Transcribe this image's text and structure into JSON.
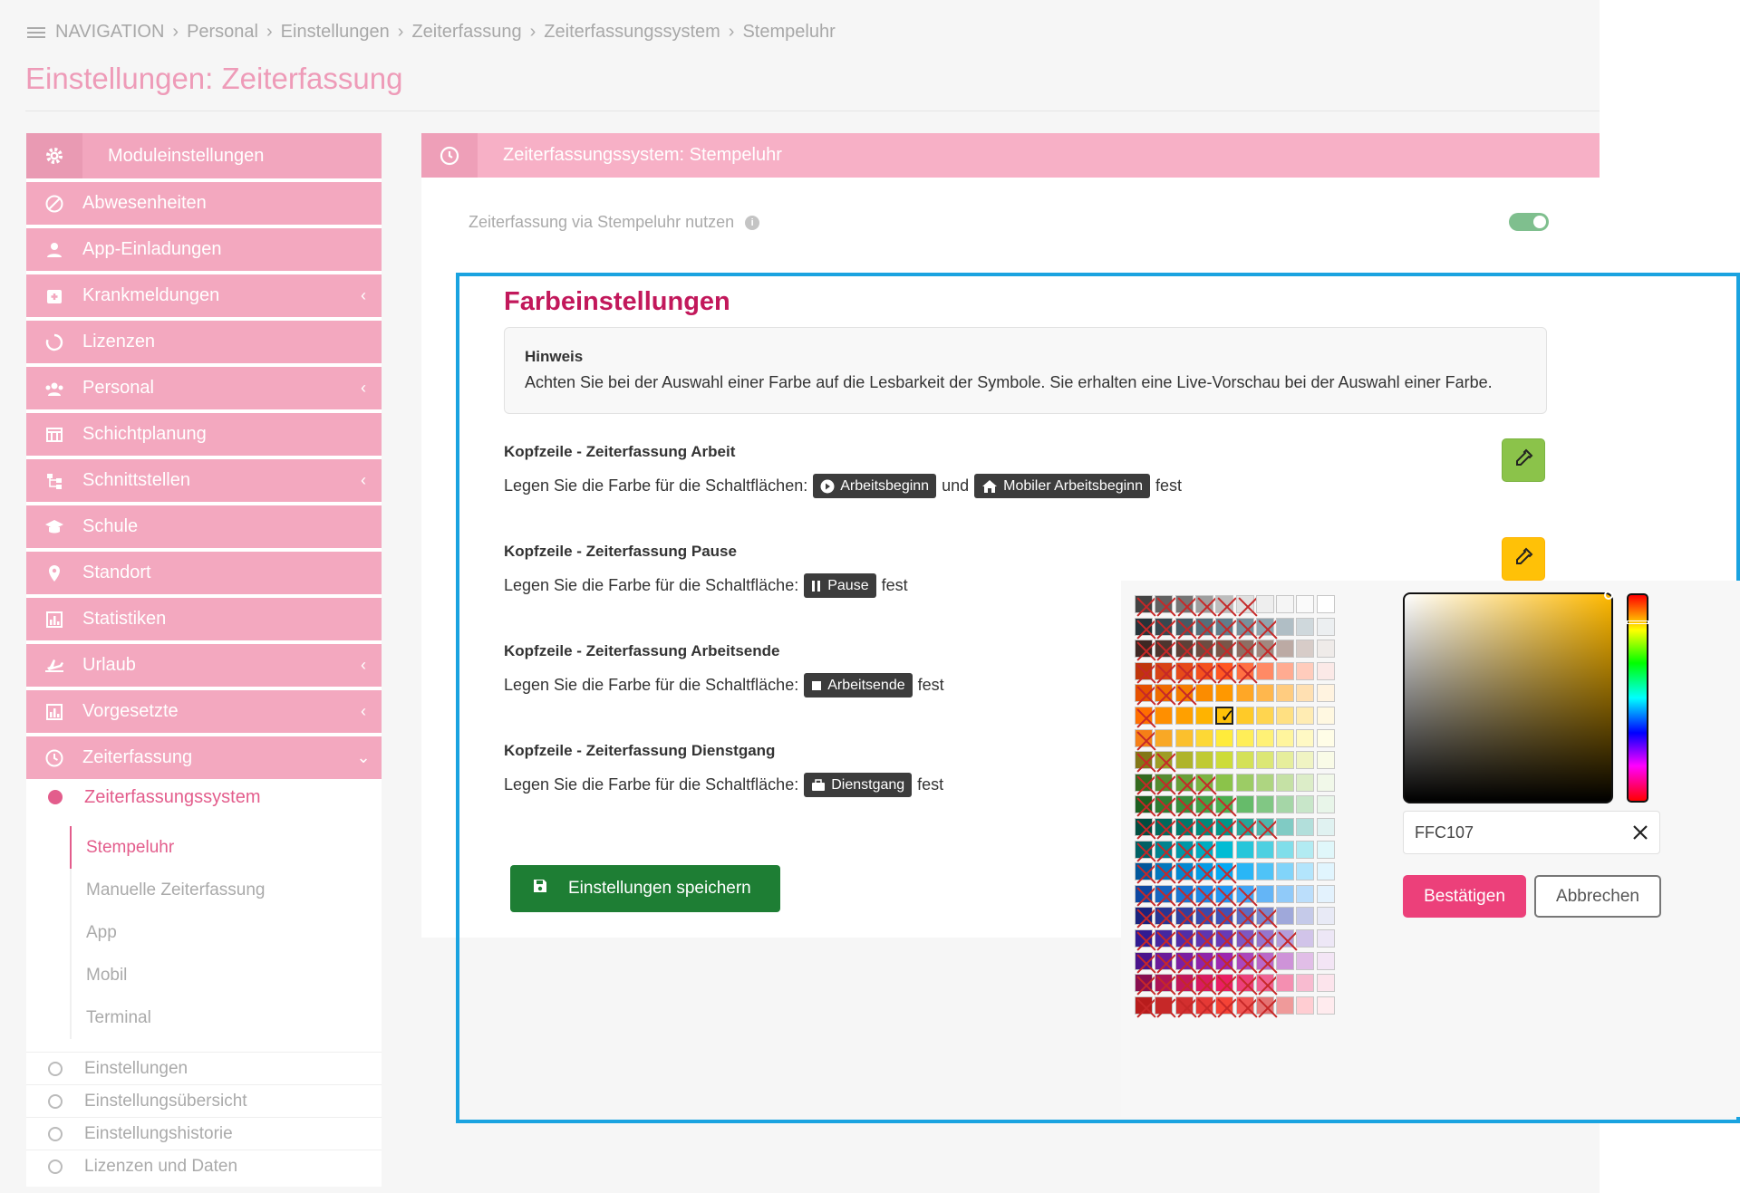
{
  "breadcrumb": [
    "NAVIGATION",
    "Personal",
    "Einstellungen",
    "Zeiterfassung",
    "Zeiterfassungssystem",
    "Stempeluhr"
  ],
  "page_title": "Einstellungen: Zeiterfassung",
  "sidebar": {
    "header": "Moduleinstellungen",
    "items": [
      {
        "label": "Abwesenheiten",
        "icon": "ban-icon",
        "chevron": false
      },
      {
        "label": "App-Einladungen",
        "icon": "user-icon",
        "chevron": false
      },
      {
        "label": "Krankmeldungen",
        "icon": "medical-icon",
        "chevron": true
      },
      {
        "label": "Lizenzen",
        "icon": "circle-notch-icon",
        "chevron": false
      },
      {
        "label": "Personal",
        "icon": "users-icon",
        "chevron": true
      },
      {
        "label": "Schichtplanung",
        "icon": "table-icon",
        "chevron": false
      },
      {
        "label": "Schnittstellen",
        "icon": "sitemap-icon",
        "chevron": true
      },
      {
        "label": "Schule",
        "icon": "graduation-cap-icon",
        "chevron": false
      },
      {
        "label": "Standort",
        "icon": "map-marker-icon",
        "chevron": false
      },
      {
        "label": "Statistiken",
        "icon": "chart-icon",
        "chevron": false
      },
      {
        "label": "Urlaub",
        "icon": "plane-icon",
        "chevron": true
      },
      {
        "label": "Vorgesetzte",
        "icon": "chart-icon",
        "chevron": true
      },
      {
        "label": "Zeiterfassung",
        "icon": "clock-icon",
        "chevron": true
      }
    ],
    "active_sub": "Zeiterfassungssystem",
    "subsub": [
      "Stempeluhr",
      "Manuelle Zeiterfassung",
      "App",
      "Mobil",
      "Terminal"
    ],
    "plain": [
      "Einstellungen",
      "Einstellungsübersicht",
      "Einstellungshistorie",
      "Lizenzen und Daten"
    ]
  },
  "main": {
    "header": "Zeiterfassungssystem: Stempeluhr",
    "toggle_label": "Zeiterfassung via Stempeluhr nutzen",
    "toggle_on": true
  },
  "colors_section": {
    "title": "Farbeinstellungen",
    "hint_title": "Hinweis",
    "hint_text": "Achten Sie bei der Auswahl einer Farbe auf die Lesbarkeit der Symbole. Sie erhalten eine Live-Vorschau bei der Auswahl einer Farbe.",
    "settings": [
      {
        "title": "Kopfzeile - Zeiterfassung Arbeit",
        "prefix": "Legen Sie die Farbe für die Schaltflächen:",
        "chip1": "Arbeitsbeginn",
        "conj": "und",
        "chip2": "Mobiler Arbeitsbeginn",
        "suffix": "fest",
        "color": "#8bc34a"
      },
      {
        "title": "Kopfzeile - Zeiterfassung Pause",
        "prefix": "Legen Sie die Farbe für die Schaltfläche:",
        "chip1": "Pause",
        "suffix": "fest",
        "color": "#ffc107"
      },
      {
        "title": "Kopfzeile - Zeiterfassung Arbeitsende",
        "prefix": "Legen Sie die Farbe für die Schaltfläche:",
        "chip1": "Arbeitsende",
        "suffix": "fest"
      },
      {
        "title": "Kopfzeile - Zeiterfassung Dienstgang",
        "prefix": "Legen Sie die Farbe für die Schaltfläche:",
        "chip1": "Dienstgang",
        "suffix": "fest"
      }
    ],
    "save_label": "Einstellungen speichern"
  },
  "picker": {
    "hex_value": "FFC107",
    "confirm_label": "Bestätigen",
    "cancel_label": "Abbrechen",
    "palette_rows": [
      {
        "colors": [
          "#424242",
          "#616161",
          "#757575",
          "#9e9e9e",
          "#bdbdbd",
          "#e0e0e0",
          "#eeeeee",
          "#f5f5f5",
          "#fafafa",
          "#ffffff"
        ],
        "disabled": 6
      },
      {
        "colors": [
          "#263238",
          "#37474f",
          "#455a64",
          "#546e7a",
          "#607d8b",
          "#78909c",
          "#90a4ae",
          "#b0bec5",
          "#cfd8dc",
          "#eceff1"
        ],
        "disabled": 7
      },
      {
        "colors": [
          "#3e2723",
          "#4e342e",
          "#5d4037",
          "#6d4c41",
          "#795548",
          "#8d6e63",
          "#a1887f",
          "#bcaaa4",
          "#d7ccc8",
          "#efebe9"
        ],
        "disabled": 7
      },
      {
        "colors": [
          "#bf360c",
          "#d84315",
          "#e64a19",
          "#f4511e",
          "#ff5722",
          "#ff7043",
          "#ff8a65",
          "#ffab91",
          "#ffccbc",
          "#fbe9e7"
        ],
        "disabled": 6
      },
      {
        "colors": [
          "#e65100",
          "#ef6c00",
          "#f57c00",
          "#fb8c00",
          "#ff9800",
          "#ffa726",
          "#ffb74d",
          "#ffcc80",
          "#ffe0b2",
          "#fff3e0"
        ],
        "disabled": 3
      },
      {
        "colors": [
          "#ff6f00",
          "#ff8f00",
          "#ffa000",
          "#ffb300",
          "#ffc107",
          "#ffca28",
          "#ffd54f",
          "#ffe082",
          "#ffecb3",
          "#fff8e1"
        ],
        "disabled": 1
      },
      {
        "colors": [
          "#f57f17",
          "#f9a825",
          "#fbc02d",
          "#fdd835",
          "#ffeb3b",
          "#ffee58",
          "#fff176",
          "#fff59d",
          "#fff9c4",
          "#fffde7"
        ],
        "disabled": 1
      },
      {
        "colors": [
          "#827717",
          "#9e9d24",
          "#afb42b",
          "#c0ca33",
          "#cddc39",
          "#d4e157",
          "#dce775",
          "#e6ee9c",
          "#f0f4c3",
          "#f9fbe7"
        ],
        "disabled": 2
      },
      {
        "colors": [
          "#33691e",
          "#558b2f",
          "#689f38",
          "#7cb342",
          "#8bc34a",
          "#9ccc65",
          "#aed581",
          "#c5e1a5",
          "#dcedc8",
          "#f1f8e9"
        ],
        "disabled": 4
      },
      {
        "colors": [
          "#1b5e20",
          "#2e7d32",
          "#388e3c",
          "#43a047",
          "#4caf50",
          "#66bb6a",
          "#81c784",
          "#a5d6a7",
          "#c8e6c9",
          "#e8f5e9"
        ],
        "disabled": 5
      },
      {
        "colors": [
          "#004d40",
          "#00695c",
          "#00796b",
          "#00897b",
          "#009688",
          "#26a69a",
          "#4db6ac",
          "#80cbc4",
          "#b2dfdb",
          "#e0f2f1"
        ],
        "disabled": 7
      },
      {
        "colors": [
          "#006064",
          "#00838f",
          "#0097a7",
          "#00acc1",
          "#00bcd4",
          "#26c6da",
          "#4dd0e1",
          "#80deea",
          "#b2ebf2",
          "#e0f7fa"
        ],
        "disabled": 4
      },
      {
        "colors": [
          "#01579b",
          "#0277bd",
          "#0288d1",
          "#039be5",
          "#03a9f4",
          "#29b6f6",
          "#4fc3f7",
          "#81d4fa",
          "#b3e5fc",
          "#e1f5fe"
        ],
        "disabled": 5
      },
      {
        "colors": [
          "#0d47a1",
          "#1565c0",
          "#1976d2",
          "#1e88e5",
          "#2196f3",
          "#42a5f5",
          "#64b5f6",
          "#90caf9",
          "#bbdefb",
          "#e3f2fd"
        ],
        "disabled": 6
      },
      {
        "colors": [
          "#1a237e",
          "#283593",
          "#303f9f",
          "#3949ab",
          "#3f51b5",
          "#5c6bc0",
          "#7986cb",
          "#9fa8da",
          "#c5cae9",
          "#e8eaf6"
        ],
        "disabled": 7
      },
      {
        "colors": [
          "#311b92",
          "#4527a0",
          "#512da8",
          "#5e35b1",
          "#673ab7",
          "#7e57c2",
          "#9575cd",
          "#b39ddb",
          "#d1c4e9",
          "#ede7f6"
        ],
        "disabled": 8
      },
      {
        "colors": [
          "#4a148c",
          "#6a1b9a",
          "#7b1fa2",
          "#8e24aa",
          "#9c27b0",
          "#ab47bc",
          "#ba68c8",
          "#ce93d8",
          "#e1bee7",
          "#f3e5f5"
        ],
        "disabled": 7
      },
      {
        "colors": [
          "#880e4f",
          "#ad1457",
          "#c2185b",
          "#d81b60",
          "#e91e63",
          "#ec407a",
          "#f06292",
          "#f48fb1",
          "#f8bbd0",
          "#fce4ec"
        ],
        "disabled": 7
      },
      {
        "colors": [
          "#b71c1c",
          "#c62828",
          "#d32f2f",
          "#e53935",
          "#f44336",
          "#ef5350",
          "#e57373",
          "#ef9a9a",
          "#ffcdd2",
          "#ffebee"
        ],
        "disabled": 7
      }
    ],
    "selected_row": 5,
    "selected_col": 4
  }
}
